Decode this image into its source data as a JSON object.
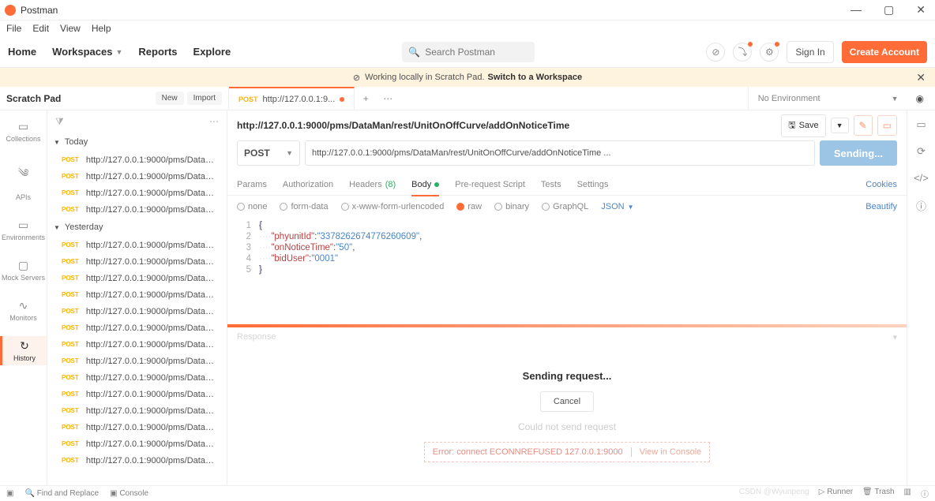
{
  "title": "Postman",
  "menu": [
    "File",
    "Edit",
    "View",
    "Help"
  ],
  "topnav": {
    "home": "Home",
    "workspaces": "Workspaces",
    "reports": "Reports",
    "explore": "Explore",
    "search_ph": "Search Postman",
    "signin": "Sign In",
    "create": "Create Account"
  },
  "banner": {
    "left": "Working locally in Scratch Pad.",
    "switch": "Switch to a Workspace"
  },
  "scratch": {
    "title": "Scratch Pad",
    "new": "New",
    "import": "Import"
  },
  "tab": {
    "method": "POST",
    "label": "http://127.0.0.1:9..."
  },
  "noenv": "No Environment",
  "leftnav": [
    "Collections",
    "APIs",
    "Environments",
    "Mock Servers",
    "Monitors",
    "History"
  ],
  "history": {
    "today": {
      "label": "Today",
      "items": [
        "http://127.0.0.1:9000/pms/DataMa...",
        "http://127.0.0.1:9000/pms/DataMa...",
        "http://127.0.0.1:9000/pms/DataMa...",
        "http://127.0.0.1:9000/pms/DataMa..."
      ]
    },
    "yesterday": {
      "label": "Yesterday",
      "items": [
        "http://127.0.0.1:9000/pms/DataMa...",
        "http://127.0.0.1:9000/pms/DataMa...",
        "http://127.0.0.1:9000/pms/DataMa...",
        "http://127.0.0.1:9000/pms/DataMa...",
        "http://127.0.0.1:9000/pms/DataMa...",
        "http://127.0.0.1:9000/pms/DataMa...",
        "http://127.0.0.1:9000/pms/DataMa...",
        "http://127.0.0.1:9000/pms/DataMa...",
        "http://127.0.0.1:9000/pms/DataMa...",
        "http://127.0.0.1:9000/pms/DataMa...",
        "http://127.0.0.1:9000/pms/DataMa...",
        "http://127.0.0.1:9000/pms/DataMa...",
        "http://127.0.0.1:9000/pms/DataMa...",
        "http://127.0.0.1:9000/pms/DataMa..."
      ]
    }
  },
  "request": {
    "url_display": "http://127.0.0.1:9000/pms/DataMan/rest/UnitOnOffCurve/addOnNoticeTime",
    "url_input": "http://127.0.0.1:9000/pms/DataMan/rest/UnitOnOffCurve/addOnNoticeTime ...",
    "method": "POST",
    "save": "Save",
    "send": "Sending...",
    "tabs": {
      "params": "Params",
      "auth": "Authorization",
      "headers": "Headers",
      "headers_n": "(8)",
      "body": "Body",
      "prereq": "Pre-request Script",
      "tests": "Tests",
      "settings": "Settings",
      "cookies": "Cookies"
    },
    "bodytypes": {
      "none": "none",
      "form": "form-data",
      "xwww": "x-www-form-urlencoded",
      "raw": "raw",
      "binary": "binary",
      "graphql": "GraphQL",
      "json": "JSON",
      "beautify": "Beautify"
    },
    "body_json": {
      "phyunitId": "3378262674776260609",
      "onNoticeTime": "50",
      "bidUser": "0001"
    }
  },
  "response": {
    "label": "Response",
    "sending": "Sending request...",
    "cancel": "Cancel",
    "couldnot": "Could not send request",
    "error": "Error: connect ECONNREFUSED 127.0.0.1:9000",
    "view": "View in Console"
  },
  "status": {
    "find": "Find and Replace",
    "console": "Console",
    "runner": "Runner",
    "trash": "Trash",
    "watermark": "CSDN @Wyunpeng"
  }
}
